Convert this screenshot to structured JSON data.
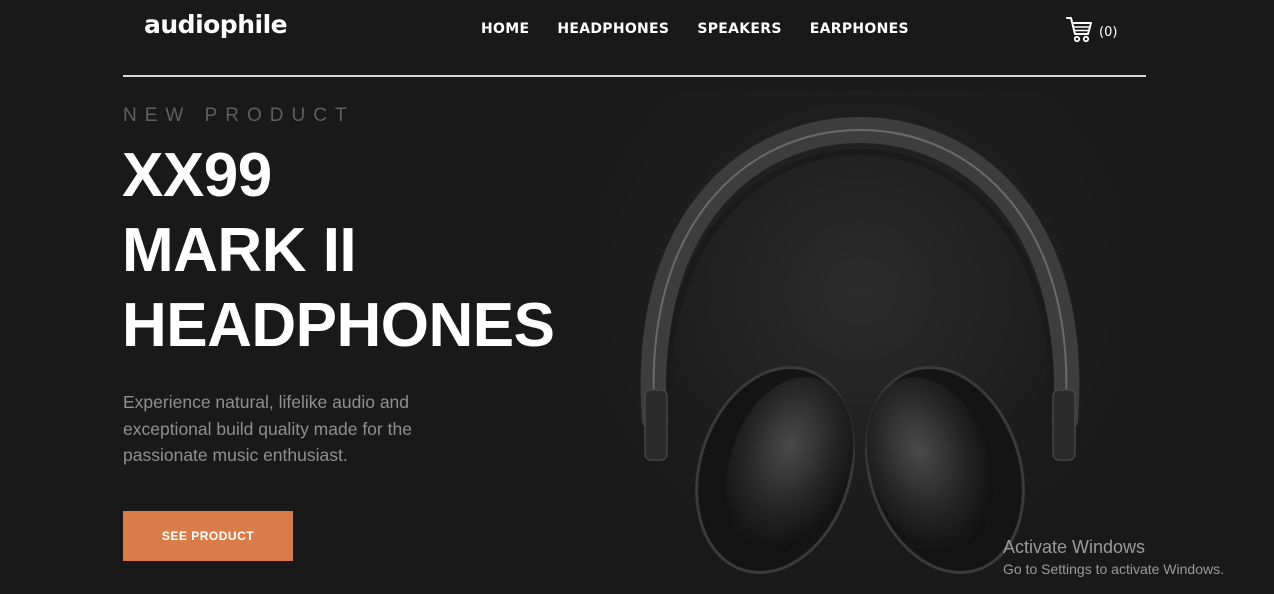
{
  "header": {
    "logo": "audiophile",
    "nav": [
      {
        "label": "HOME"
      },
      {
        "label": "HEADPHONES"
      },
      {
        "label": "SPEAKERS"
      },
      {
        "label": "EARPHONES"
      }
    ],
    "cart_count": "(0)"
  },
  "hero": {
    "overline": "NEW PRODUCT",
    "title_lines": [
      "XX99",
      "MARK II",
      "HEADPHONES"
    ],
    "description": "Experience natural, lifelike audio and exceptional build quality made for the passionate music enthusiast.",
    "cta_label": "SEE PRODUCT"
  },
  "watermark": {
    "title": "Activate Windows",
    "subtitle": "Go to Settings to activate Windows."
  },
  "colors": {
    "background": "#191919",
    "accent": "#d87d4a",
    "text": "#ffffff",
    "muted": "#8f8f8f"
  },
  "icons": {
    "cart": "shopping-cart-icon"
  }
}
